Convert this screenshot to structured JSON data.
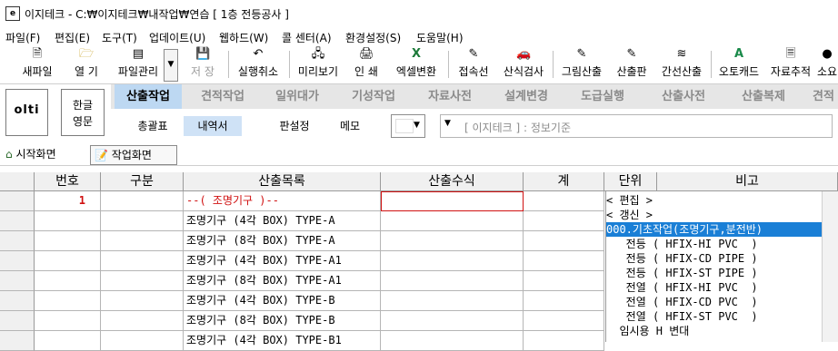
{
  "window": {
    "title": "이지테크 - C:₩이지테크₩내작업₩연습 [ 1층 전등공사 ]"
  },
  "menu": [
    "파일(F)",
    "편집(E)",
    "도구(T)",
    "업데이트(U)",
    "웹하드(W)",
    "콜 센터(A)",
    "환경설정(S)",
    "도움말(H)"
  ],
  "toolbar": {
    "new": "새파일",
    "open": "열 기",
    "filemgr": "파일관리",
    "save": "저 장",
    "undo": "실행취소",
    "preview": "미리보기",
    "print": "인 쇄",
    "excel": "엑셀변환",
    "joint": "접속선",
    "check": "산식검사",
    "drawing": "그림산출",
    "board": "산출판",
    "linecalc": "간선산출",
    "autocad": "오토캐드",
    "tracking": "자료추적",
    "small": "소요"
  },
  "logo": "olti",
  "lang": {
    "ko": "한글",
    "en": "영문"
  },
  "tabs": [
    "산출작업",
    "견적작업",
    "일위대가",
    "기성작업",
    "자료사전",
    "설계변경",
    "도급실행",
    "산출사전",
    "산출복제",
    "견적"
  ],
  "subtabs": [
    "총괄표",
    "내역서",
    "판설정",
    "메모"
  ],
  "combo": "[ 이지테크 ] : 정보기준",
  "screentabs": {
    "home": "시작화면",
    "work": "작업화면"
  },
  "grid": {
    "headers": [
      "번호",
      "구분",
      "산출목록",
      "산출수식",
      "계",
      "단위",
      "비고"
    ],
    "rows": [
      {
        "no": "1",
        "item": "--( 조명기구 )--",
        "red": true
      },
      {
        "no": "",
        "item": "조명기구 (4각 BOX) TYPE-A",
        "red": false
      },
      {
        "no": "",
        "item": "조명기구 (8각 BOX) TYPE-A",
        "red": false
      },
      {
        "no": "",
        "item": "조명기구 (4각 BOX) TYPE-A1",
        "red": false
      },
      {
        "no": "",
        "item": "조명기구 (8각 BOX) TYPE-A1",
        "red": false
      },
      {
        "no": "",
        "item": "조명기구 (4각 BOX) TYPE-B",
        "red": false
      },
      {
        "no": "",
        "item": "조명기구 (8각 BOX) TYPE-B",
        "red": false
      },
      {
        "no": "",
        "item": "조명기구 (4각 BOX) TYPE-B1",
        "red": false
      }
    ]
  },
  "dropdown": {
    "items": [
      "< 편집 >",
      "< 갱신 >",
      "000.기초작업(조명기구,분전반)",
      "   전등 ( HFIX-HI PVC  )",
      "   전등 ( HFIX-CD PIPE )",
      "   전등 ( HFIX-ST PIPE )",
      "   전열 ( HFIX-HI PVC  )",
      "   전열 ( HFIX-CD PVC  )",
      "   전열 ( HFIX-ST PVC  )",
      "  임시용 H 변대"
    ],
    "selected_index": 2
  }
}
